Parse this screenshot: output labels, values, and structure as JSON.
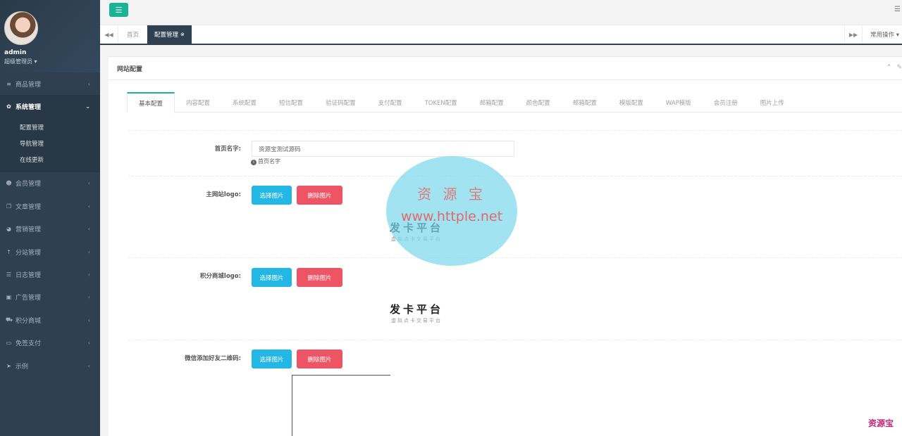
{
  "colors": {
    "sidebar": "#2f4050",
    "accent": "#1ab394",
    "primary_button": "#23b7e5",
    "danger_button": "#ed5565"
  },
  "sidebar": {
    "user_name": "admin",
    "user_role": "超级管理员 ▾",
    "items": [
      {
        "label": "商品管理",
        "icon": "menu-icon"
      },
      {
        "label": "系统管理",
        "icon": "gear-icon"
      },
      {
        "label": "会员管理",
        "icon": "users-icon"
      },
      {
        "label": "文章管理",
        "icon": "copy-icon"
      },
      {
        "label": "营销管理",
        "icon": "pie-icon"
      },
      {
        "label": "分站管理",
        "icon": "arrow-up-icon"
      },
      {
        "label": "日志管理",
        "icon": "list-icon"
      },
      {
        "label": "广告管理",
        "icon": "picture-icon"
      },
      {
        "label": "积分商城",
        "icon": "cart-icon"
      },
      {
        "label": "免签支付",
        "icon": "card-icon"
      },
      {
        "label": "示例",
        "icon": "send-icon"
      }
    ],
    "submenu": [
      "配置管理",
      "导航管理",
      "在线更新"
    ]
  },
  "tabs": {
    "home": "首页",
    "active": "配置管理",
    "common_ops": "常用操作 ▾"
  },
  "panel": {
    "title": "网站配置",
    "config_tabs": [
      "基本配置",
      "内容配置",
      "系统配置",
      "短信配置",
      "验证码配置",
      "支付配置",
      "TOKEN配置",
      "邮箱配置",
      "颜色配置",
      "邮箱配置",
      "模版配置",
      "WAP模版",
      "会员注册",
      "图片上传"
    ]
  },
  "form": {
    "home_name_label": "首页名字:",
    "home_name_value": "资源宝测试源码",
    "home_name_help": "首页名字",
    "main_logo_label": "主网站logo:",
    "points_logo_label": "积分商城logo:",
    "wechat_qr_label": "微信添加好友二维码:",
    "choose_image": "选择图片",
    "delete_image": "删除图片",
    "logo_text": "发卡平台",
    "logo_subtext": "虚拟点卡交易平台"
  },
  "watermark": {
    "name": "资 源 宝",
    "url": "www.httple.net",
    "corner": "资源宝"
  }
}
